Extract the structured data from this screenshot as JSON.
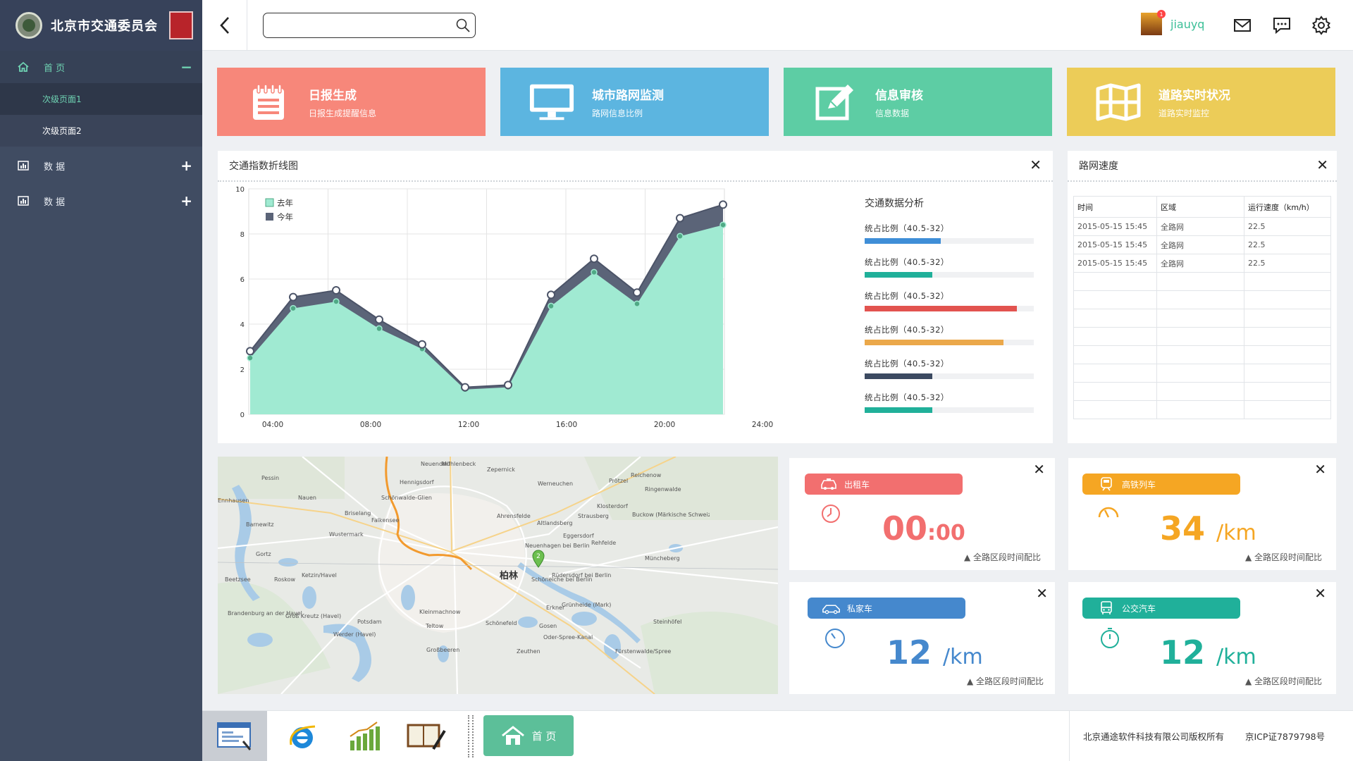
{
  "app": {
    "title": "北京市交通委员会"
  },
  "sidebar": {
    "items": [
      {
        "label": "首 页",
        "toggle": "−",
        "icon": "home-icon"
      },
      {
        "label": "次级页面1"
      },
      {
        "label": "次级页面2"
      },
      {
        "label": "数 据",
        "toggle": "+",
        "icon": "bar-chart-icon"
      },
      {
        "label": "数 据",
        "toggle": "+",
        "icon": "bar-chart-icon"
      }
    ]
  },
  "header": {
    "search_value": "",
    "username": "jiauyq",
    "notification_count": "1"
  },
  "tiles": [
    {
      "title": "日报生成",
      "subtitle": "日报生成提醒信息",
      "color": "#f7877a"
    },
    {
      "title": "城市路网监测",
      "subtitle": "路网信息比例",
      "color": "#5cb5e0"
    },
    {
      "title": "信息审核",
      "subtitle": "信息数据",
      "color": "#5dcda4"
    },
    {
      "title": "道路实时状况",
      "subtitle": "道路实时监控",
      "color": "#eccc58"
    }
  ],
  "traffic_panel": {
    "title": "交通指数折线图",
    "close": "✕",
    "analysis_title": "交通数据分析",
    "bars": [
      {
        "label": "统占比例（40.5-32）",
        "value": 0.45,
        "color": "#3f8ed7"
      },
      {
        "label": "统占比例（40.5-32）",
        "value": 0.4,
        "color": "#20b09a"
      },
      {
        "label": "统占比例（40.5-32）",
        "value": 0.9,
        "color": "#e2534f"
      },
      {
        "label": "统占比例（40.5-32）",
        "value": 0.82,
        "color": "#eba84a"
      },
      {
        "label": "统占比例（40.5-32）",
        "value": 0.4,
        "color": "#3c4a61"
      },
      {
        "label": "统占比例（40.5-32）",
        "value": 0.4,
        "color": "#20b09a"
      }
    ]
  },
  "chart_data": {
    "type": "area",
    "title": "",
    "xlabel": "",
    "ylabel": "",
    "ylim": [
      0,
      10
    ],
    "yticks": [
      "0",
      "2",
      "4",
      "6",
      "8",
      "10"
    ],
    "xticks": [
      "04:00",
      "08:00",
      "12:00",
      "16:00",
      "20:00",
      "24:00"
    ],
    "x": [
      1,
      2,
      3,
      4,
      5,
      6,
      7,
      8,
      9,
      10,
      11,
      12
    ],
    "grid": true,
    "legend": "top-left",
    "series": [
      {
        "name": "去年",
        "color": "#a0ead2",
        "values": [
          2.5,
          4.7,
          5.0,
          3.8,
          2.9,
          1.1,
          1.2,
          4.8,
          6.3,
          4.9,
          7.9,
          8.4
        ]
      },
      {
        "name": "今年",
        "color": "#5b6478",
        "values": [
          2.8,
          5.2,
          5.5,
          4.2,
          3.1,
          1.2,
          1.3,
          5.3,
          6.9,
          5.4,
          8.7,
          9.3
        ]
      }
    ]
  },
  "speed_panel": {
    "title": "路网速度",
    "close": "✕",
    "columns": [
      "时间",
      "区域",
      "运行速度（km/h）"
    ],
    "rows": [
      [
        "2015-05-15 15:45",
        "全路网",
        "22.5"
      ],
      [
        "2015-05-15 15:45",
        "全路网",
        "22.5"
      ],
      [
        "2015-05-15 15:45",
        "全路网",
        "22.5"
      ],
      [
        "",
        "",
        ""
      ],
      [
        "",
        "",
        ""
      ],
      [
        "",
        "",
        ""
      ],
      [
        "",
        "",
        ""
      ],
      [
        "",
        "",
        ""
      ],
      [
        "",
        "",
        ""
      ],
      [
        "",
        "",
        ""
      ],
      [
        "",
        "",
        ""
      ]
    ]
  },
  "map": {
    "center_label": "柏林",
    "marker": "2",
    "places": [
      "Neuendorf",
      "Mühlenbeck",
      "Zepernick",
      "Hennigsdorf",
      "Pessin",
      "Nauen",
      "Schönwalde-Glien",
      "Briselang",
      "Falkensee",
      "Barnewitz",
      "Wustermark",
      "Gortz",
      "Roskow",
      "Ketzin/Havel",
      "Beetzsee",
      "Brandenburg an der Havel",
      "Groß Kreutz (Havel)",
      "Potsdam",
      "Werder (Havel)",
      "Kleinmachnow",
      "Teltow",
      "Großbeeren",
      "Schönefeld",
      "Zeuthen",
      "Erkner",
      "Grünheide (Mark)",
      "Schöneiche bei Berlin",
      "Rüdersdorf bei Berlin",
      "Neuenhagen bei Berlin",
      "Eggersdorf",
      "Rehfelde",
      "Strausberg",
      "Klosterdorf",
      "Buckow (Märkische Schweiz)",
      "Müncheberg",
      "Steinhöfel",
      "Fürstenwalde/Spree",
      "Reichenow",
      "Ringenwalde",
      "Prötzel",
      "Werneuchen",
      "Ahrensfelde",
      "Altlandsberg",
      "Gosen",
      "Oder-Spree-Kanal",
      "Ennhausen"
    ]
  },
  "stats": [
    {
      "label": "出租车",
      "value_main": "00",
      "value_sub": ":00",
      "unit": "",
      "footer": "▲ 全路区段时间配比",
      "pill_color": "#f26f6f",
      "value_color": "#f26f6f",
      "icon": "taxi-icon",
      "gauge_icon": "clock-icon",
      "close": "✕"
    },
    {
      "label": "高铁列车",
      "value_main": "34",
      "value_sub": "",
      "unit": "/km",
      "footer": "▲ 全路区段时间配比",
      "pill_color": "#f5a623",
      "value_color": "#f5a623",
      "icon": "train-icon",
      "gauge_icon": "speedometer-icon",
      "close": "✕"
    },
    {
      "label": "私家车",
      "value_main": "12",
      "value_sub": "",
      "unit": "/km",
      "footer": "▲ 全路区段时间配比",
      "pill_color": "#4588cd",
      "value_color": "#4588cd",
      "icon": "car-icon",
      "gauge_icon": "gauge-icon",
      "close": "✕"
    },
    {
      "label": "公交汽车",
      "value_main": "12",
      "value_sub": "",
      "unit": "/km",
      "footer": "▲ 全路区段时间配比",
      "pill_color": "#20b09a",
      "value_color": "#20b09a",
      "icon": "bus-icon",
      "gauge_icon": "stopwatch-icon",
      "close": "✕"
    }
  ],
  "footer": {
    "home_label": "首 页",
    "copyright": "北京通途软件科技有限公司版权所有",
    "icp": "京ICP证7879798号"
  }
}
